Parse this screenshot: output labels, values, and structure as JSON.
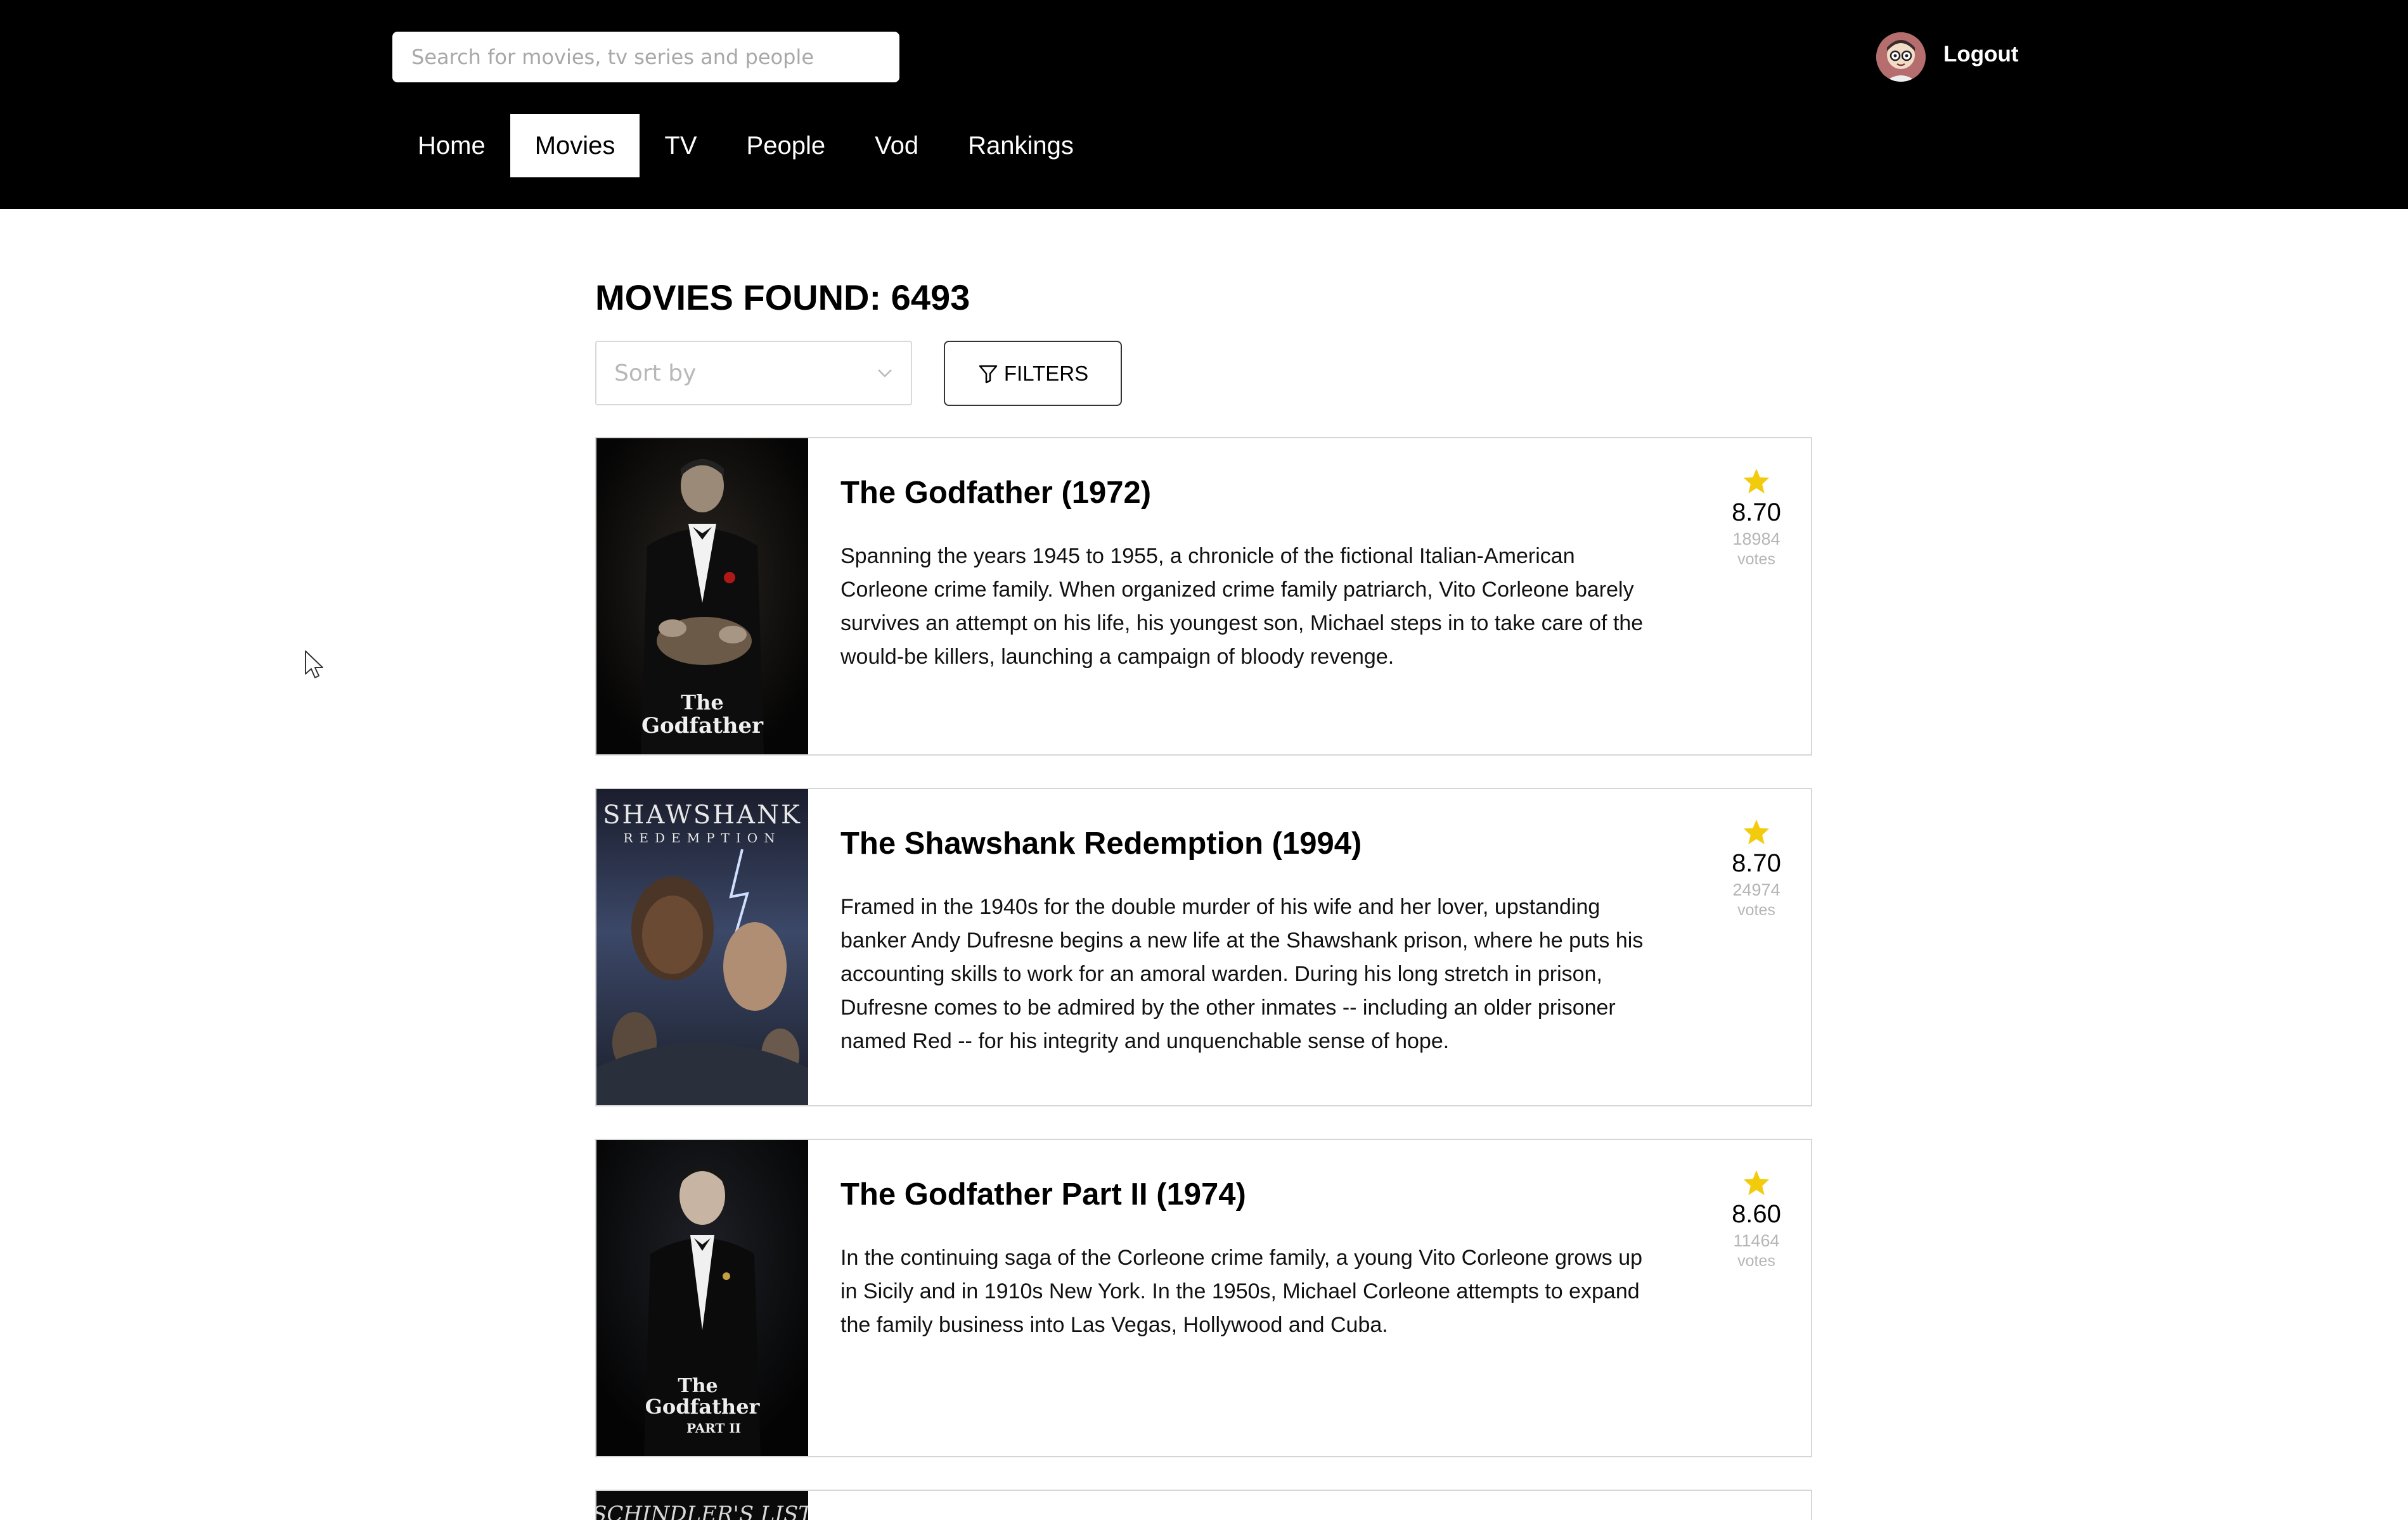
{
  "header": {
    "search_placeholder": "Search for movies, tv series and people",
    "logout_label": "Logout",
    "nav": [
      {
        "label": "Home",
        "active": false
      },
      {
        "label": "Movies",
        "active": true
      },
      {
        "label": "TV",
        "active": false
      },
      {
        "label": "People",
        "active": false
      },
      {
        "label": "Vod",
        "active": false
      },
      {
        "label": "Rankings",
        "active": false
      }
    ]
  },
  "main": {
    "count_title": "MOVIES FOUND: 6493",
    "sort_placeholder": "Sort by",
    "filters_label": "FILTERS",
    "movies": [
      {
        "title": "The Godfather (1972)",
        "description": "Spanning the years 1945 to 1955, a chronicle of the fictional Italian-American Corleone crime family. When organized crime family patriarch, Vito Corleone barely survives an attempt on his life, his youngest son, Michael steps in to take care of the would-be killers, launching a campaign of bloody revenge.",
        "rating": "8.70",
        "votes": "18984",
        "votes_label": "votes",
        "poster_text": "The Godfather"
      },
      {
        "title": "The Shawshank Redemption (1994)",
        "description": "Framed in the 1940s for the double murder of his wife and her lover, upstanding banker Andy Dufresne begins a new life at the Shawshank prison, where he puts his accounting skills to work for an amoral warden. During his long stretch in prison, Dufresne comes to be admired by the other inmates -- including an older prisoner named Red -- for his integrity and unquenchable sense of hope.",
        "rating": "8.70",
        "votes": "24974",
        "votes_label": "votes",
        "poster_text": "THE SHAWSHANK REDEMPTION"
      },
      {
        "title": "The Godfather Part II (1974)",
        "description": "In the continuing saga of the Corleone crime family, a young Vito Corleone grows up in Sicily and in 1910s New York. In the 1950s, Michael Corleone attempts to expand the family business into Las Vegas, Hollywood and Cuba.",
        "rating": "8.60",
        "votes": "11464",
        "votes_label": "votes",
        "poster_text": "The Godfather PART II"
      },
      {
        "poster_text": "SCHINDLER'S LIST"
      }
    ]
  },
  "colors": {
    "header_bg": "#000000",
    "star": "#f2cc0c",
    "card_border": "#d6d6d6",
    "muted_text": "#b5b5b5"
  },
  "icons": {
    "rating": "star-icon",
    "filters": "filter-funnel-icon",
    "sort": "chevron-down-icon",
    "user": "avatar-icon"
  }
}
